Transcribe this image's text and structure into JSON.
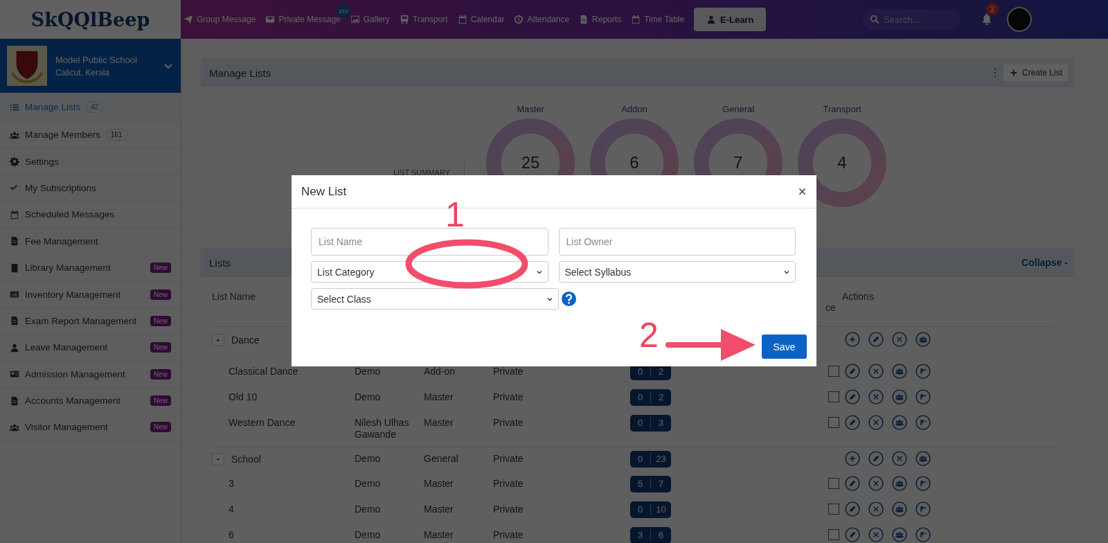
{
  "topbar": {
    "logo": "SkQQlBeep",
    "nav": [
      {
        "label": "Group Message"
      },
      {
        "label": "Private Message",
        "badge": "310"
      },
      {
        "label": "Gallery"
      },
      {
        "label": "Transport"
      },
      {
        "label": "Calendar"
      },
      {
        "label": "Attendance"
      },
      {
        "label": "Reports"
      },
      {
        "label": "Time Table"
      }
    ],
    "elearn": "E-Learn",
    "search": {
      "placeholder": "Search..."
    },
    "notifications": "2"
  },
  "school": {
    "name": "Model Public School",
    "location": "Calicut, Kerala"
  },
  "sidebar": {
    "items": [
      {
        "label": "Manage Lists",
        "count": "42",
        "selected": true
      },
      {
        "label": "Manage Members",
        "count": "161",
        "selected": false
      },
      {
        "label": "Settings",
        "selected": false
      },
      {
        "label": "My Subscriptions",
        "selected": false
      },
      {
        "label": "Scheduled Messages",
        "selected": false
      },
      {
        "label": "Fee Management",
        "selected": false
      },
      {
        "label": "Library Management",
        "badge": "New",
        "selected": false
      },
      {
        "label": "Inventory Management",
        "badge": "New",
        "selected": false
      },
      {
        "label": "Exam Report Management",
        "badge": "New",
        "selected": false
      },
      {
        "label": "Leave Management",
        "badge": "New",
        "selected": false
      },
      {
        "label": "Admission Management",
        "badge": "New",
        "selected": false
      },
      {
        "label": "Accounts Management",
        "badge": "New",
        "selected": false
      },
      {
        "label": "Visitor Management",
        "badge": "New",
        "selected": false
      }
    ]
  },
  "manage_lists": {
    "title": "Manage Lists",
    "create": "Create List",
    "summary_label": "LIST SUMMARY",
    "summary": [
      {
        "label": "Master",
        "value": "25"
      },
      {
        "label": "Addon",
        "value": "6"
      },
      {
        "label": "General",
        "value": "7"
      },
      {
        "label": "Transport",
        "value": "4"
      }
    ]
  },
  "lists": {
    "title": "Lists",
    "collapse": "Collapse -",
    "columns": [
      "List Name",
      "ce",
      "Actions"
    ],
    "groups": [
      {
        "toggle": "-",
        "name": "Dance",
        "expanded": true,
        "children": [
          {
            "name": "Classical Dance",
            "owner": "Demo",
            "category": "Add-on",
            "type": "Private",
            "counts": [
              "0",
              "2"
            ],
            "checked": false
          },
          {
            "name": "Old 10",
            "owner": "Demo",
            "category": "Master",
            "type": "Private",
            "counts": [
              "0",
              "2"
            ],
            "checked": false
          },
          {
            "name": "Western Dance",
            "owner": "Nilesh Ulhas Gawande",
            "category": "Master",
            "type": "Private",
            "counts": [
              "0",
              "3"
            ],
            "checked": false
          }
        ]
      },
      {
        "toggle": "-",
        "name": "School",
        "owner": "Demo",
        "category": "General",
        "type": "Private",
        "counts": [
          "0",
          "23"
        ],
        "expanded": true,
        "children": [
          {
            "name": "3",
            "owner": "Demo",
            "category": "Master",
            "type": "Private",
            "counts": [
              "5",
              "7"
            ],
            "checked": false
          },
          {
            "name": "4",
            "owner": "Demo",
            "category": "Master",
            "type": "Private",
            "counts": [
              "0",
              "10"
            ],
            "checked": false
          },
          {
            "name": "6",
            "owner": "Demo",
            "category": "Master",
            "type": "Private",
            "counts": [
              "3",
              "6"
            ],
            "checked": false
          }
        ]
      }
    ]
  },
  "modal": {
    "title": "New List",
    "fields": [
      {
        "kind": "input",
        "placeholder": "List Name"
      },
      {
        "kind": "input",
        "placeholder": "List Owner"
      },
      {
        "kind": "select",
        "value": "List Category"
      },
      {
        "kind": "select",
        "value": "Select Syllabus"
      },
      {
        "kind": "select",
        "value": "Select Class",
        "help": true
      }
    ],
    "save": "Save",
    "annotations": [
      {
        "label": "1"
      },
      {
        "label": "2"
      }
    ]
  }
}
